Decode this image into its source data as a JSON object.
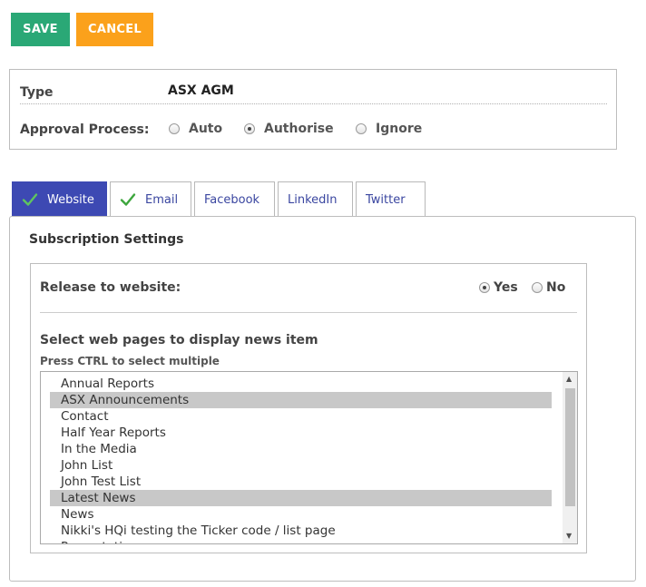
{
  "toolbar": {
    "save_label": "SAVE",
    "cancel_label": "CANCEL"
  },
  "details": {
    "type_label": "Type",
    "type_value": "ASX AGM",
    "approval_label": "Approval Process:",
    "approval_options": [
      {
        "label": "Auto",
        "checked": false
      },
      {
        "label": "Authorise",
        "checked": true
      },
      {
        "label": "Ignore",
        "checked": false
      }
    ]
  },
  "tabs": [
    {
      "label": "Website",
      "active": true,
      "checked": true
    },
    {
      "label": "Email",
      "active": false,
      "checked": true
    },
    {
      "label": "Facebook",
      "active": false,
      "checked": false
    },
    {
      "label": "LinkedIn",
      "active": false,
      "checked": false
    },
    {
      "label": "Twitter",
      "active": false,
      "checked": false
    }
  ],
  "subscription": {
    "title": "Subscription Settings",
    "release_label": "Release to website:",
    "release_options": [
      {
        "label": "Yes",
        "checked": true
      },
      {
        "label": "No",
        "checked": false
      }
    ],
    "select_label": "Select web pages to display news item",
    "hint": "Press CTRL to select multiple",
    "pages": [
      {
        "label": "Annual Reports",
        "selected": false
      },
      {
        "label": "ASX Announcements",
        "selected": true
      },
      {
        "label": "Contact",
        "selected": false
      },
      {
        "label": "Half Year Reports",
        "selected": false
      },
      {
        "label": "In the Media",
        "selected": false
      },
      {
        "label": "John List",
        "selected": false
      },
      {
        "label": "John Test List",
        "selected": false
      },
      {
        "label": "Latest News",
        "selected": true
      },
      {
        "label": "News",
        "selected": false
      },
      {
        "label": "Nikki's HQi testing the Ticker code / list page",
        "selected": false
      },
      {
        "label": "Presentations",
        "selected": false
      }
    ]
  },
  "colors": {
    "save": "#2aa876",
    "cancel": "#fba11b",
    "active_tab": "#3d49b3",
    "tab_text": "#3a46a0",
    "checkmark": "#3da63d"
  }
}
